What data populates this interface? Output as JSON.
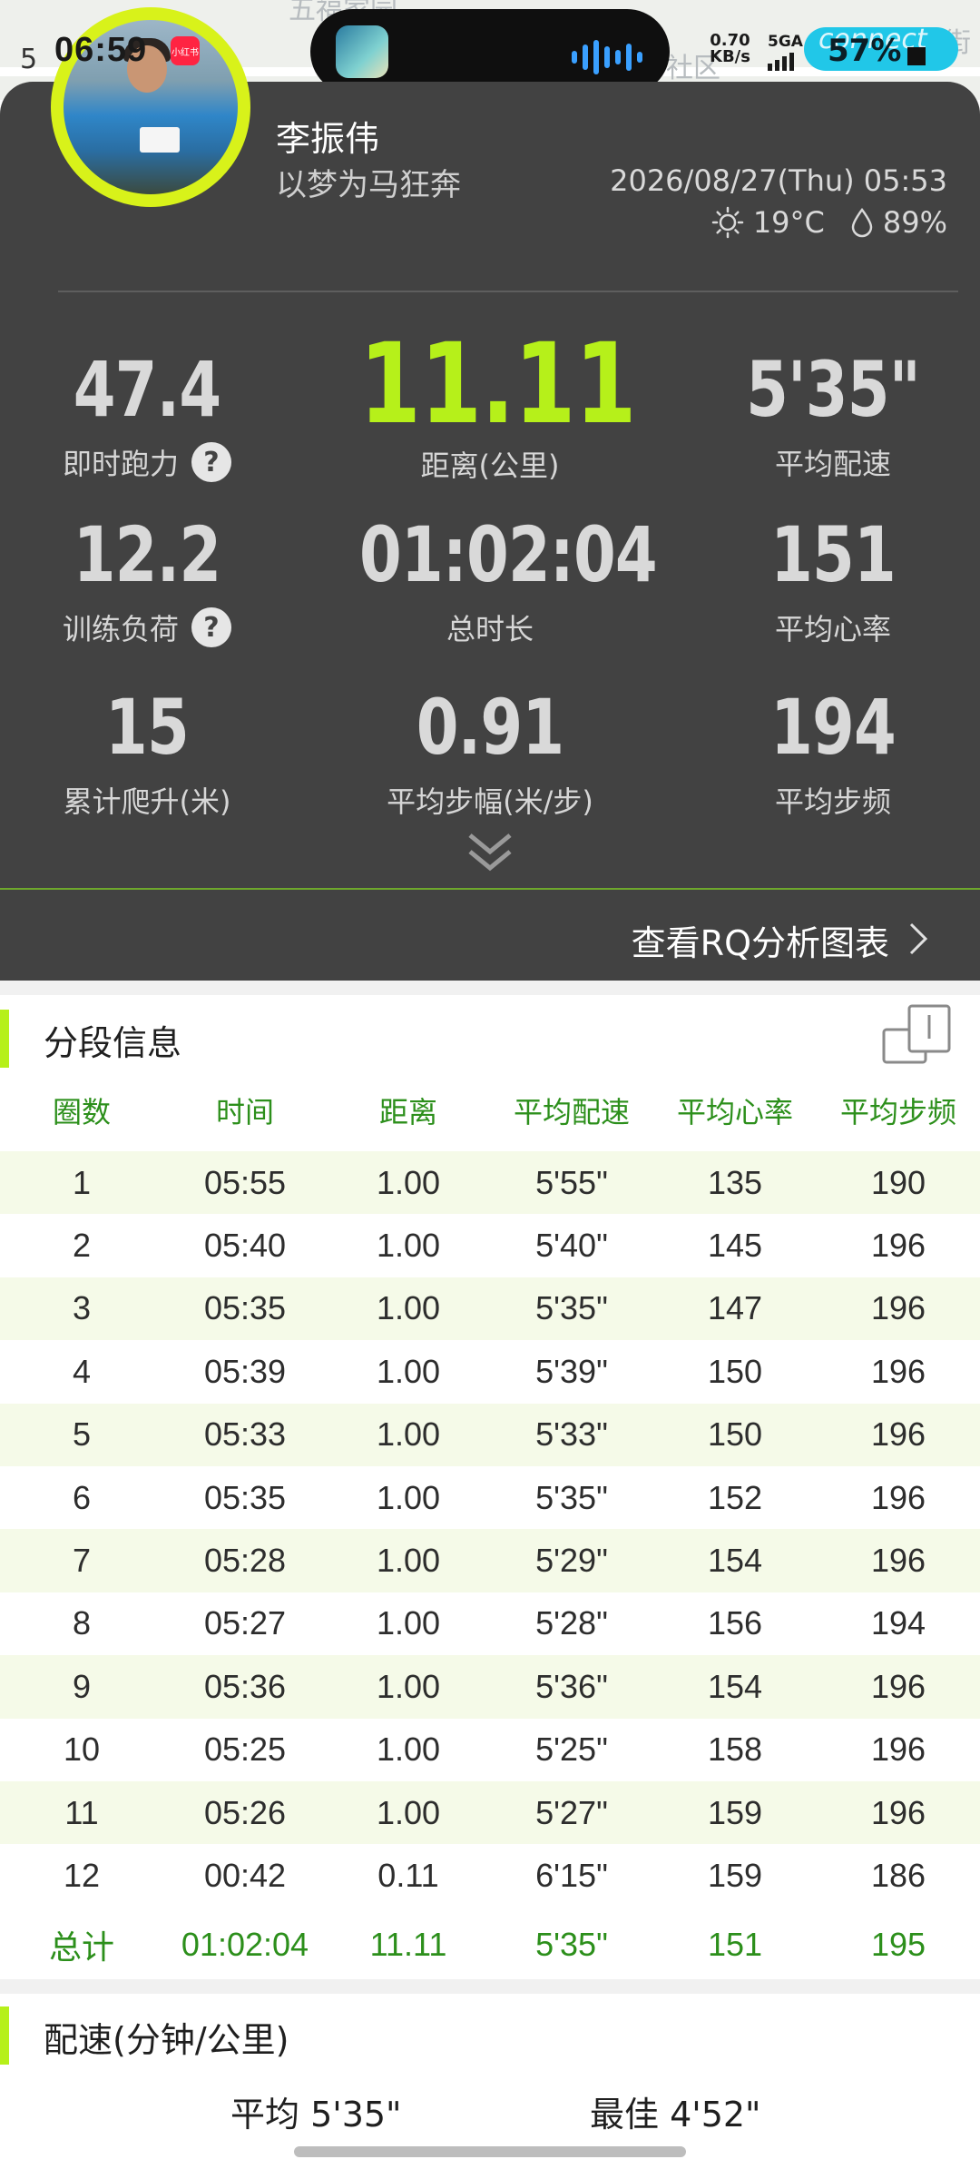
{
  "status_bar": {
    "time_prefix": "5",
    "time": "06:59",
    "net_speed": "0.70",
    "net_unit": "KB/s",
    "network_type": "5GA",
    "battery": "57%",
    "connect_label": "connect"
  },
  "map_labels": [
    "五福家园",
    "社区",
    "街"
  ],
  "profile": {
    "badge": "小红书",
    "name": "李振伟",
    "motto": "以梦为马狂奔",
    "datetime": "2026/08/27(Thu) 05:53",
    "temperature": "19°C",
    "humidity": "89%"
  },
  "metrics": [
    {
      "value": "47.4",
      "label": "即时跑力",
      "help": true
    },
    {
      "value": "11.11",
      "label": "距离(公里)",
      "highlight": true
    },
    {
      "value": "5'35\"",
      "label": "平均配速"
    },
    {
      "value": "12.2",
      "label": "训练负荷",
      "help": true
    },
    {
      "value": "01:02:04",
      "label": "总时长"
    },
    {
      "value": "151",
      "label": "平均心率"
    },
    {
      "value": "15",
      "label": "累计爬升(米)"
    },
    {
      "value": "0.91",
      "label": "平均步幅(米/步)"
    },
    {
      "value": "194",
      "label": "平均步频"
    }
  ],
  "help_glyph": "?",
  "rq_link": "查看RQ分析图表",
  "segments": {
    "title": "分段信息",
    "headers": [
      "圈数",
      "时间",
      "距离",
      "平均配速",
      "平均心率",
      "平均步频"
    ],
    "rows": [
      [
        "1",
        "05:55",
        "1.00",
        "5'55\"",
        "135",
        "190"
      ],
      [
        "2",
        "05:40",
        "1.00",
        "5'40\"",
        "145",
        "196"
      ],
      [
        "3",
        "05:35",
        "1.00",
        "5'35\"",
        "147",
        "196"
      ],
      [
        "4",
        "05:39",
        "1.00",
        "5'39\"",
        "150",
        "196"
      ],
      [
        "5",
        "05:33",
        "1.00",
        "5'33\"",
        "150",
        "196"
      ],
      [
        "6",
        "05:35",
        "1.00",
        "5'35\"",
        "152",
        "196"
      ],
      [
        "7",
        "05:28",
        "1.00",
        "5'29\"",
        "154",
        "196"
      ],
      [
        "8",
        "05:27",
        "1.00",
        "5'28\"",
        "156",
        "194"
      ],
      [
        "9",
        "05:36",
        "1.00",
        "5'36\"",
        "154",
        "196"
      ],
      [
        "10",
        "05:25",
        "1.00",
        "5'25\"",
        "158",
        "196"
      ],
      [
        "11",
        "05:26",
        "1.00",
        "5'27\"",
        "159",
        "196"
      ],
      [
        "12",
        "00:42",
        "0.11",
        "6'15\"",
        "159",
        "186"
      ]
    ],
    "total": [
      "总计",
      "01:02:04",
      "11.11",
      "5'35\"",
      "151",
      "195"
    ]
  },
  "pace": {
    "title": "配速(分钟/公里)",
    "average": "平均 5'35\"",
    "best": "最佳 4'52\""
  },
  "colors": {
    "card_bg": "#424242",
    "accent_green": "#b6f01a",
    "table_green": "#2c8f1b",
    "battery_pill": "#21c7e8"
  }
}
